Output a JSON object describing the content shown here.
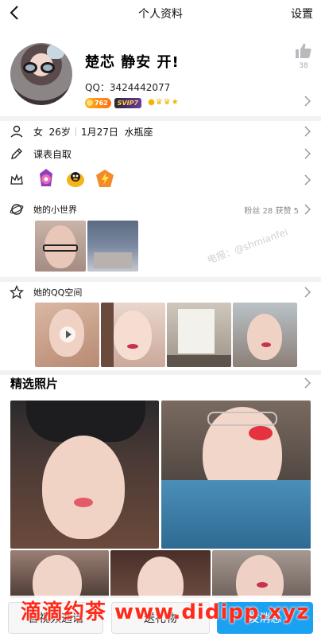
{
  "header": {
    "title": "个人资料",
    "settings_label": "设置"
  },
  "profile": {
    "nickname": "楚芯 静安 开!",
    "qq": "QQ：3424442077",
    "level_badge": "762",
    "vip_badge": "SVIP7",
    "like_count": "38"
  },
  "rows": {
    "basic_info": {
      "gender": "女",
      "age": "26岁",
      "birthday": "1月27日",
      "zodiac": "水瓶座"
    },
    "schedule": "课表自取"
  },
  "small_world": {
    "title": "她的小世界",
    "stats": "粉丝 28  获赞 5"
  },
  "qzone": {
    "title": "她的QQ空间"
  },
  "featured": {
    "title": "精选照片"
  },
  "actions": {
    "phone": "音视频通话",
    "gift": "送礼物",
    "message": "发消息"
  },
  "overlays": {
    "watermark": "滴滴约茶 www.didipp.xyz",
    "faint_watermark": "电报：@shmianfei"
  },
  "colors": {
    "accent": "#1aa1f2",
    "watermark": "#ff2a1a"
  }
}
